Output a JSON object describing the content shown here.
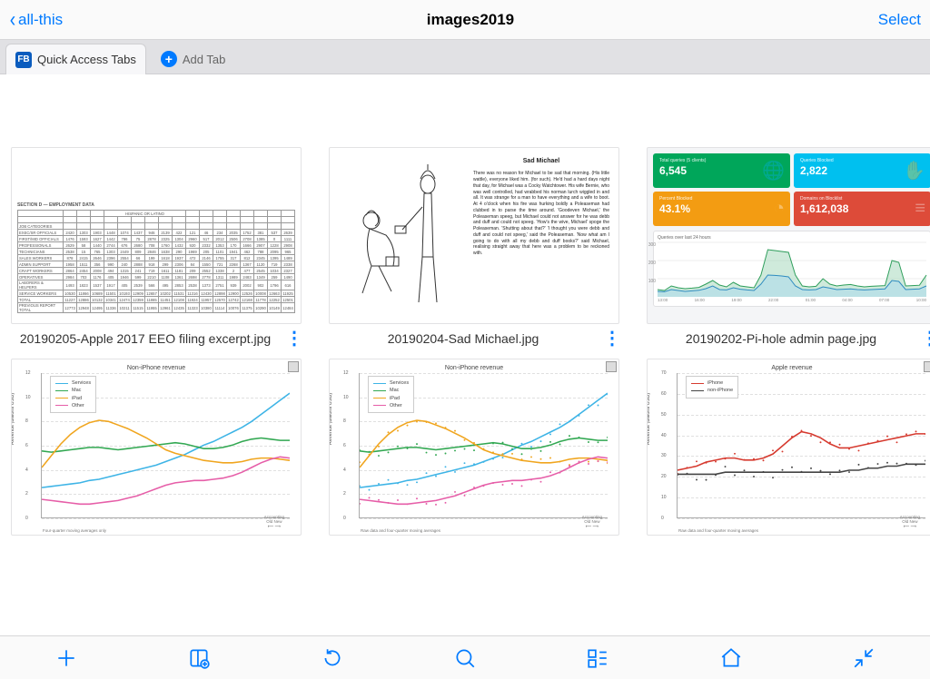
{
  "nav": {
    "back_label": "all-this",
    "title": "images2019",
    "select_label": "Select"
  },
  "tabs": {
    "quick_access_label": "Quick Access Tabs",
    "add_tab_label": "Add Tab",
    "fb_badge_text": "FB"
  },
  "files": [
    {
      "name": "20190205-Apple 2017 EEO filing excerpt.jpg"
    },
    {
      "name": "20190204-Sad Michael.jpg"
    },
    {
      "name": "20190202-Pi-hole admin page.jpg"
    }
  ],
  "eeo": {
    "heading": "SECTION D — EMPLOYMENT DATA",
    "group_header": "HISPANIC OR LATINO",
    "row_labels": [
      "JOB CATEGORIES",
      "EXEC/SR OFFICIALS",
      "FIRST/MID OFFICIALS",
      "PROFESSIONALS",
      "TECHNICIANS",
      "SALES WORKERS",
      "ADMIN SUPPORT",
      "CRAFT WORKERS",
      "OPERATIVES",
      "LABORERS & HELPERS",
      "SERVICE WORKERS",
      "TOTAL",
      "PREVIOUS REPORT TOTAL"
    ]
  },
  "michael": {
    "title": "Sad Michael",
    "body": "There was no reason for Michael to be sad that morning. (His little wattle), everyone liked him. (for such). He'd had a hard days night that day, for Michael was a Cocky Watchtower. His wife Bernie, who was well controlled, had wrabbed his norman lurch wiggled in and all. It was strange for a man to have everything and a wife to boot. At 4 o'clock when his fire was hurking boldly a Poleaseman had clubbed in to parse the time around. 'Goodeven Michael,' the Poleaseman speeg, but Michael could not answer for he was debb and duff and could not speeg. 'How's the wive, Michael' spoge the Poleaseman. 'Shutting about that?' 'I thought you were debb and duff and could not speeg,' said the Poleaseman. 'Now what am I going to do with all my debb and duff books?' said Michael, realising straight away that here was a problem to be reckoned with."
  },
  "pihole": {
    "cards": [
      {
        "label": "Total queries (5 clients)",
        "value": "6,545",
        "color": "#00a65a",
        "icon": "🌐"
      },
      {
        "label": "Queries Blocked",
        "value": "2,822",
        "color": "#00c0ef",
        "icon": "✋"
      },
      {
        "label": "Percent Blocked",
        "value": "43.1%",
        "color": "#f39c12",
        "icon": "◔"
      },
      {
        "label": "Domains on Blocklist",
        "value": "1,612,038",
        "color": "#dd4b39",
        "icon": "≡"
      }
    ],
    "chart_title": "Queries over last 24 hours",
    "x_ticks": [
      "13:00",
      "16:00",
      "19:00",
      "22:00",
      "01:00",
      "04:00",
      "07:00",
      "10:00"
    ]
  },
  "chart_data": [
    {
      "id": "non_iphone_ma",
      "type": "line",
      "title": "Non-iPhone revenue",
      "ylabel": "Revenue (billions USD)",
      "ylim": [
        0,
        12
      ],
      "yticks": [
        0,
        2,
        4,
        6,
        8,
        10,
        12
      ],
      "footnote": "Four-quarter moving averages only",
      "accounting_note": "Accounting\nOld  New",
      "series": [
        {
          "name": "Services",
          "color": "#3eb4e6",
          "values": [
            2.3,
            2.4,
            2.5,
            2.6,
            2.7,
            2.9,
            3.0,
            3.2,
            3.4,
            3.6,
            3.8,
            4.0,
            4.2,
            4.5,
            4.8,
            5.1,
            5.5,
            5.9,
            6.2,
            6.6,
            7.0,
            7.4,
            7.9,
            8.5,
            9.1,
            9.7,
            10.3
          ]
        },
        {
          "name": "Mac",
          "color": "#32a852",
          "values": [
            5.4,
            5.3,
            5.4,
            5.5,
            5.6,
            5.7,
            5.7,
            5.6,
            5.5,
            5.6,
            5.7,
            5.8,
            5.9,
            6.0,
            6.1,
            6.0,
            5.8,
            5.6,
            5.6,
            5.7,
            5.9,
            6.2,
            6.4,
            6.5,
            6.4,
            6.3,
            6.3
          ]
        },
        {
          "name": "iPad",
          "color": "#f0a51e",
          "values": [
            4.0,
            5.0,
            6.0,
            6.8,
            7.4,
            7.8,
            8.0,
            7.9,
            7.6,
            7.3,
            6.9,
            6.5,
            6.0,
            5.5,
            5.2,
            5.0,
            4.8,
            4.6,
            4.5,
            4.4,
            4.4,
            4.5,
            4.7,
            4.8,
            4.8,
            4.7,
            4.6
          ]
        },
        {
          "name": "Other",
          "color": "#e65ea8",
          "values": [
            1.3,
            1.2,
            1.1,
            1.0,
            0.9,
            0.9,
            1.0,
            1.1,
            1.2,
            1.4,
            1.6,
            1.9,
            2.2,
            2.5,
            2.7,
            2.8,
            2.9,
            2.9,
            3.0,
            3.1,
            3.3,
            3.6,
            4.0,
            4.4,
            4.7,
            4.9,
            4.8
          ]
        }
      ]
    },
    {
      "id": "non_iphone_raw",
      "type": "line",
      "title": "Non-iPhone revenue",
      "ylabel": "Revenue (billions USD)",
      "ylim": [
        0,
        12
      ],
      "yticks": [
        0,
        2,
        4,
        6,
        8,
        10,
        12
      ],
      "footnote": "Raw data and four-quarter moving averages",
      "accounting_note": "Accounting\nOld  New",
      "series": [
        {
          "name": "Services",
          "color": "#3eb4e6",
          "values": [
            2.3,
            2.4,
            2.5,
            2.6,
            2.7,
            2.9,
            3.0,
            3.2,
            3.4,
            3.6,
            3.8,
            4.0,
            4.2,
            4.5,
            4.8,
            5.1,
            5.5,
            5.9,
            6.2,
            6.6,
            7.0,
            7.4,
            7.9,
            8.5,
            9.1,
            9.7,
            10.3
          ]
        },
        {
          "name": "Mac",
          "color": "#32a852",
          "values": [
            5.4,
            5.3,
            5.4,
            5.5,
            5.6,
            5.7,
            5.7,
            5.6,
            5.5,
            5.6,
            5.7,
            5.8,
            5.9,
            6.0,
            6.1,
            6.0,
            5.8,
            5.6,
            5.6,
            5.7,
            5.9,
            6.2,
            6.4,
            6.5,
            6.4,
            6.3,
            6.3
          ]
        },
        {
          "name": "iPad",
          "color": "#f0a51e",
          "values": [
            4.0,
            5.0,
            6.0,
            6.8,
            7.4,
            7.8,
            8.0,
            7.9,
            7.6,
            7.3,
            6.9,
            6.5,
            6.0,
            5.5,
            5.2,
            5.0,
            4.8,
            4.6,
            4.5,
            4.4,
            4.4,
            4.5,
            4.7,
            4.8,
            4.8,
            4.7,
            4.6
          ]
        },
        {
          "name": "Other",
          "color": "#e65ea8",
          "values": [
            1.3,
            1.2,
            1.1,
            1.0,
            0.9,
            0.9,
            1.0,
            1.1,
            1.2,
            1.4,
            1.6,
            1.9,
            2.2,
            2.5,
            2.7,
            2.8,
            2.9,
            2.9,
            3.0,
            3.1,
            3.3,
            3.6,
            4.0,
            4.4,
            4.7,
            4.9,
            4.8
          ]
        }
      ],
      "scatter": true
    },
    {
      "id": "apple_revenue",
      "type": "line",
      "title": "Apple revenue",
      "ylabel": "Revenue (billions USD)",
      "ylim": [
        0,
        70
      ],
      "yticks": [
        0,
        10,
        20,
        30,
        40,
        50,
        60,
        70
      ],
      "footnote": "Raw data and four-quarter moving averages",
      "accounting_note": "Accounting\nOld  New",
      "series": [
        {
          "name": "iPhone",
          "color": "#d63a2f",
          "values": [
            22,
            23,
            24,
            26,
            27,
            28,
            28,
            27,
            27,
            28,
            30,
            34,
            38,
            41,
            40,
            38,
            35,
            33,
            33,
            34,
            35,
            36,
            37,
            38,
            39,
            40,
            40
          ]
        },
        {
          "name": "non-iPhone",
          "color": "#444444",
          "values": [
            20,
            20,
            20,
            20,
            20,
            21,
            21,
            21,
            21,
            21,
            21,
            21,
            21,
            21,
            21,
            21,
            21,
            21,
            22,
            22,
            23,
            23,
            24,
            24,
            25,
            25,
            25
          ]
        }
      ],
      "scatter": true
    }
  ],
  "pihole_spark": {
    "ylim": [
      0,
      300
    ],
    "x": [
      0,
      1,
      2,
      3,
      4,
      5,
      6,
      7,
      8,
      9,
      10,
      11,
      12,
      13,
      14,
      15,
      16,
      17,
      18,
      19,
      20,
      21,
      22,
      23,
      24,
      25,
      26,
      27,
      28,
      29,
      30,
      31,
      32,
      33,
      34,
      35,
      36,
      37,
      38,
      39
    ],
    "permitted": [
      40,
      35,
      60,
      50,
      45,
      48,
      52,
      70,
      90,
      65,
      55,
      80,
      60,
      55,
      50,
      120,
      260,
      255,
      250,
      245,
      120,
      60,
      55,
      58,
      100,
      70,
      60,
      65,
      68,
      60,
      55,
      58,
      60,
      62,
      200,
      190,
      60,
      62,
      64,
      120
    ],
    "blocked": [
      30,
      28,
      40,
      35,
      30,
      33,
      36,
      45,
      60,
      40,
      38,
      50,
      42,
      38,
      35,
      70,
      120,
      118,
      115,
      110,
      60,
      40,
      38,
      40,
      55,
      48,
      40,
      42,
      44,
      40,
      38,
      40,
      42,
      44,
      90,
      85,
      40,
      42,
      44,
      60
    ]
  }
}
